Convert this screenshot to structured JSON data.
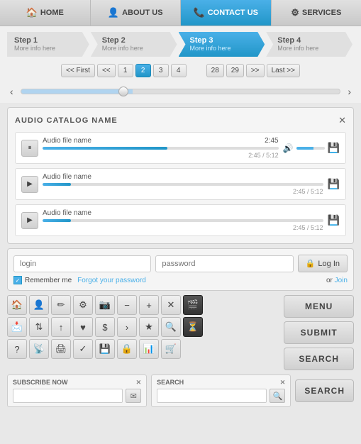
{
  "nav": {
    "items": [
      {
        "id": "home",
        "label": "HOME",
        "icon": "🏠",
        "active": false
      },
      {
        "id": "about",
        "label": "ABOUT US",
        "icon": "👤",
        "active": false
      },
      {
        "id": "contact",
        "label": "CONTACT US",
        "icon": "📞",
        "active": true
      },
      {
        "id": "services",
        "label": "SERVICES",
        "icon": "⚙",
        "active": false
      }
    ]
  },
  "steps": [
    {
      "num": "Step 1",
      "sub": "More info here",
      "active": false
    },
    {
      "num": "Step 2",
      "sub": "More info here",
      "active": false
    },
    {
      "num": "Step 3",
      "sub": "More info here",
      "active": true
    },
    {
      "num": "Step 4",
      "sub": "More info here",
      "active": false
    }
  ],
  "pagination": {
    "first": "<< First",
    "prev2": "<<",
    "pages": [
      "1",
      "2",
      "3",
      "4",
      "",
      "28",
      "29"
    ],
    "active_page": "2",
    "next2": ">>",
    "last": "Last >>"
  },
  "audio": {
    "catalog_title": "AUDIO CATALOG NAME",
    "close_label": "✕",
    "items": [
      {
        "name": "Audio file name",
        "time": "2:45",
        "duration": "2:45 / 5:12",
        "progress": 53,
        "playing": true
      },
      {
        "name": "Audio file name",
        "time": "",
        "duration": "2:45 / 5:12",
        "progress": 10,
        "playing": false
      },
      {
        "name": "Audio file name",
        "time": "",
        "duration": "2:45 / 5:12",
        "progress": 10,
        "playing": false
      }
    ]
  },
  "login": {
    "login_placeholder": "login",
    "password_placeholder": "password",
    "login_btn": "Log In",
    "lock_icon": "🔒",
    "remember_label": "Remember me",
    "forgot_label": "Forgot your password",
    "or_text": "or",
    "join_label": "Join"
  },
  "icons": {
    "grid1": [
      "🏠",
      "👤",
      "✏",
      "⚙",
      "📷",
      "−",
      "+",
      "✕",
      "🎬",
      "📩",
      "↓↑",
      "↑",
      "❤",
      "$",
      ">",
      "★",
      "🔍",
      "?",
      "📡",
      "🖨",
      "✓",
      "💾",
      "🔒",
      "📊",
      "🛒",
      "⏳"
    ],
    "grid2": [
      "🎬",
      "📩",
      "↓↑",
      "↑",
      "❤",
      "$",
      ">",
      "★",
      "🔍",
      "⏳"
    ]
  },
  "side_buttons": {
    "menu": "MENU",
    "submit": "SUBMIT",
    "search": "SEARCH"
  },
  "subscribe": {
    "label": "SUBSCRIBE NOW",
    "close": "✕",
    "placeholder": "",
    "send_icon": "✉"
  },
  "search_box": {
    "label": "SEARCH",
    "close": "✕",
    "placeholder": "",
    "icon": "🔍"
  }
}
